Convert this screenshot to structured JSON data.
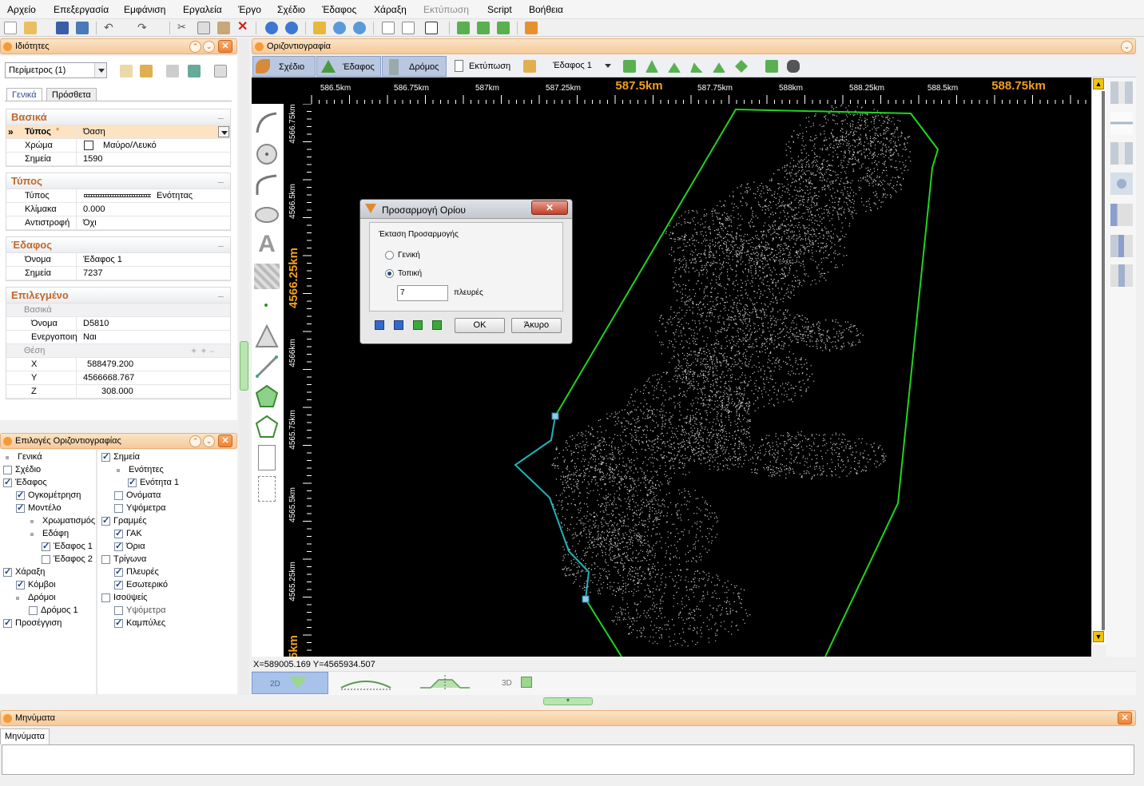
{
  "menu": [
    "Αρχείο",
    "Επεξεργασία",
    "Εμφάνιση",
    "Εργαλεία",
    "Έργο",
    "Σχέδιο",
    "Έδαφος",
    "Χάραξη",
    "Εκτύπωση",
    "Script",
    "Βοήθεια"
  ],
  "properties_panel": {
    "title": "Ιδιότητες",
    "selector": "Περίμετρος (1)",
    "tabs": [
      "Γενικά",
      "Πρόσθετα"
    ],
    "sections": {
      "basic": {
        "title": "Βασικά",
        "rows": [
          {
            "k": "Τύπος",
            "v": "Όαση"
          },
          {
            "k": "Χρώμα",
            "v": "Μαύρο/Λευκό"
          },
          {
            "k": "Σημεία",
            "v": "1590"
          }
        ]
      },
      "type": {
        "title": "Τύπος",
        "rows": [
          {
            "k": "Τύπος",
            "v": "Ενότητας"
          },
          {
            "k": "Κλίμακα",
            "v": "0.000"
          },
          {
            "k": "Αντιστροφή",
            "v": "Όχι"
          }
        ]
      },
      "terrain": {
        "title": "Έδαφος",
        "rows": [
          {
            "k": "Όνομα",
            "v": "Έδαφος 1"
          },
          {
            "k": "Σημεία",
            "v": "7237"
          }
        ]
      },
      "selected": {
        "title": "Επιλεγμένο",
        "sub_basic": "Βασικά",
        "rows": [
          {
            "k": "Όνομα",
            "v": "D5810"
          },
          {
            "k": "Ενεργοποιη",
            "v": "Ναι"
          }
        ],
        "sub_pos": "Θέση",
        "pos": [
          {
            "k": "X",
            "v": "588479.200"
          },
          {
            "k": "Y",
            "v": "4566668.767"
          },
          {
            "k": "Z",
            "v": "308.000"
          }
        ]
      }
    }
  },
  "options_panel": {
    "title": "Επιλογές Οριζοντιογραφίας",
    "left": [
      "Γενικά",
      "Σχέδιο",
      "Έδαφος",
      "Ογκομέτρηση",
      "Μοντέλο",
      "Χρωματισμός",
      "Εδάφη",
      "Έδαφος 1",
      "Έδαφος 2",
      "Χάραξη",
      "Κόμβοι",
      "Δρόμοι",
      "Δρόμος 1",
      "Προσέγγιση"
    ],
    "right": [
      "Σημεία",
      "Ενότητες",
      "Ενότητα 1",
      "Ονόματα",
      "Υψόμετρα",
      "Γραμμές",
      "ΓΑΚ",
      "Όρια",
      "Τρίγωνα",
      "Πλευρές",
      "Εσωτερικό",
      "Ισοϋψείς",
      "Υψόμετρα",
      "Καμπύλες"
    ]
  },
  "view": {
    "title": "Οριζοντιογραφία",
    "tabs": [
      "Σχέδιο",
      "Έδαφος",
      "Δρόμος",
      "Εκτύπωση"
    ],
    "terrain_select": "Έδαφος 1",
    "x_ticks": [
      "586.5km",
      "586.75km",
      "587km",
      "587.25km",
      "587.5km",
      "587.75km",
      "588km",
      "588.25km",
      "588.5km",
      "588.75km"
    ],
    "y_ticks": [
      "4566.75km",
      "4566.5km",
      "4566.25km",
      "4566km",
      "4565.75km",
      "4565.5km",
      "4565.25km",
      "5km"
    ],
    "status": "X=589005.169  Y=4565934.507",
    "mode_labels": [
      "2D",
      "3D"
    ]
  },
  "dialog": {
    "title": "Προσαρμογή Ορίου",
    "group": "Έκταση Προσαρμογής",
    "opt1": "Γενική",
    "opt2": "Τοπική",
    "value": "7",
    "unit": "πλευρές",
    "ok": "OK",
    "cancel": "Άκυρο"
  },
  "messages": {
    "title": "Μηνύματα",
    "tab": "Μηνύματα"
  },
  "colors": {
    "accent": "#f5c99a",
    "boundary": "#1fd41f",
    "boundary_local": "#22b3b8",
    "points": "#c8c8c8",
    "ruler_major": "#f0a020"
  }
}
